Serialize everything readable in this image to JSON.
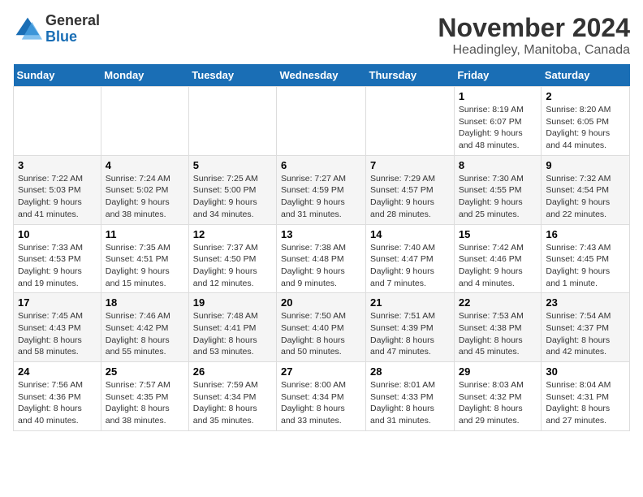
{
  "logo": {
    "line1": "General",
    "line2": "Blue"
  },
  "title": "November 2024",
  "subtitle": "Headingley, Manitoba, Canada",
  "days_of_week": [
    "Sunday",
    "Monday",
    "Tuesday",
    "Wednesday",
    "Thursday",
    "Friday",
    "Saturday"
  ],
  "weeks": [
    [
      {
        "day": "",
        "info": ""
      },
      {
        "day": "",
        "info": ""
      },
      {
        "day": "",
        "info": ""
      },
      {
        "day": "",
        "info": ""
      },
      {
        "day": "",
        "info": ""
      },
      {
        "day": "1",
        "info": "Sunrise: 8:19 AM\nSunset: 6:07 PM\nDaylight: 9 hours and 48 minutes."
      },
      {
        "day": "2",
        "info": "Sunrise: 8:20 AM\nSunset: 6:05 PM\nDaylight: 9 hours and 44 minutes."
      }
    ],
    [
      {
        "day": "3",
        "info": "Sunrise: 7:22 AM\nSunset: 5:03 PM\nDaylight: 9 hours and 41 minutes."
      },
      {
        "day": "4",
        "info": "Sunrise: 7:24 AM\nSunset: 5:02 PM\nDaylight: 9 hours and 38 minutes."
      },
      {
        "day": "5",
        "info": "Sunrise: 7:25 AM\nSunset: 5:00 PM\nDaylight: 9 hours and 34 minutes."
      },
      {
        "day": "6",
        "info": "Sunrise: 7:27 AM\nSunset: 4:59 PM\nDaylight: 9 hours and 31 minutes."
      },
      {
        "day": "7",
        "info": "Sunrise: 7:29 AM\nSunset: 4:57 PM\nDaylight: 9 hours and 28 minutes."
      },
      {
        "day": "8",
        "info": "Sunrise: 7:30 AM\nSunset: 4:55 PM\nDaylight: 9 hours and 25 minutes."
      },
      {
        "day": "9",
        "info": "Sunrise: 7:32 AM\nSunset: 4:54 PM\nDaylight: 9 hours and 22 minutes."
      }
    ],
    [
      {
        "day": "10",
        "info": "Sunrise: 7:33 AM\nSunset: 4:53 PM\nDaylight: 9 hours and 19 minutes."
      },
      {
        "day": "11",
        "info": "Sunrise: 7:35 AM\nSunset: 4:51 PM\nDaylight: 9 hours and 15 minutes."
      },
      {
        "day": "12",
        "info": "Sunrise: 7:37 AM\nSunset: 4:50 PM\nDaylight: 9 hours and 12 minutes."
      },
      {
        "day": "13",
        "info": "Sunrise: 7:38 AM\nSunset: 4:48 PM\nDaylight: 9 hours and 9 minutes."
      },
      {
        "day": "14",
        "info": "Sunrise: 7:40 AM\nSunset: 4:47 PM\nDaylight: 9 hours and 7 minutes."
      },
      {
        "day": "15",
        "info": "Sunrise: 7:42 AM\nSunset: 4:46 PM\nDaylight: 9 hours and 4 minutes."
      },
      {
        "day": "16",
        "info": "Sunrise: 7:43 AM\nSunset: 4:45 PM\nDaylight: 9 hours and 1 minute."
      }
    ],
    [
      {
        "day": "17",
        "info": "Sunrise: 7:45 AM\nSunset: 4:43 PM\nDaylight: 8 hours and 58 minutes."
      },
      {
        "day": "18",
        "info": "Sunrise: 7:46 AM\nSunset: 4:42 PM\nDaylight: 8 hours and 55 minutes."
      },
      {
        "day": "19",
        "info": "Sunrise: 7:48 AM\nSunset: 4:41 PM\nDaylight: 8 hours and 53 minutes."
      },
      {
        "day": "20",
        "info": "Sunrise: 7:50 AM\nSunset: 4:40 PM\nDaylight: 8 hours and 50 minutes."
      },
      {
        "day": "21",
        "info": "Sunrise: 7:51 AM\nSunset: 4:39 PM\nDaylight: 8 hours and 47 minutes."
      },
      {
        "day": "22",
        "info": "Sunrise: 7:53 AM\nSunset: 4:38 PM\nDaylight: 8 hours and 45 minutes."
      },
      {
        "day": "23",
        "info": "Sunrise: 7:54 AM\nSunset: 4:37 PM\nDaylight: 8 hours and 42 minutes."
      }
    ],
    [
      {
        "day": "24",
        "info": "Sunrise: 7:56 AM\nSunset: 4:36 PM\nDaylight: 8 hours and 40 minutes."
      },
      {
        "day": "25",
        "info": "Sunrise: 7:57 AM\nSunset: 4:35 PM\nDaylight: 8 hours and 38 minutes."
      },
      {
        "day": "26",
        "info": "Sunrise: 7:59 AM\nSunset: 4:34 PM\nDaylight: 8 hours and 35 minutes."
      },
      {
        "day": "27",
        "info": "Sunrise: 8:00 AM\nSunset: 4:34 PM\nDaylight: 8 hours and 33 minutes."
      },
      {
        "day": "28",
        "info": "Sunrise: 8:01 AM\nSunset: 4:33 PM\nDaylight: 8 hours and 31 minutes."
      },
      {
        "day": "29",
        "info": "Sunrise: 8:03 AM\nSunset: 4:32 PM\nDaylight: 8 hours and 29 minutes."
      },
      {
        "day": "30",
        "info": "Sunrise: 8:04 AM\nSunset: 4:31 PM\nDaylight: 8 hours and 27 minutes."
      }
    ]
  ]
}
